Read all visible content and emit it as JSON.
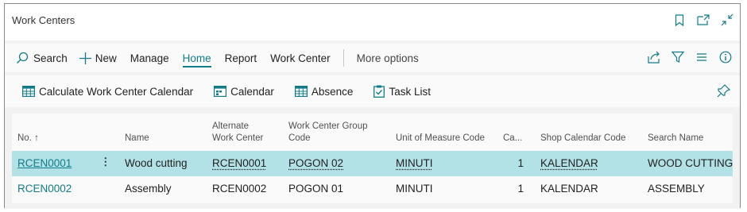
{
  "window": {
    "title": "Work Centers"
  },
  "actions": {
    "search": "Search",
    "new": "New",
    "manage": "Manage",
    "home": "Home",
    "report": "Report",
    "work_center": "Work Center",
    "more": "More options"
  },
  "promoted": {
    "calc": "Calculate Work Center Calendar",
    "calendar": "Calendar",
    "absence": "Absence",
    "task_list": "Task List"
  },
  "table": {
    "headers": {
      "no": "No. ↑",
      "name": "Name",
      "alt_1": "Alternate",
      "alt_2": "Work Center",
      "group_1": "Work Center Group",
      "group_2": "Code",
      "uom": "Unit of Measure Code",
      "cap": "Ca...",
      "shopcal": "Shop Calendar Code",
      "search": "Search Name"
    },
    "rows": [
      {
        "no": "RCEN0001",
        "name": "Wood cutting",
        "alt": "RCEN0001",
        "group": "POGON 02",
        "uom": "MINUTI",
        "cap": "1",
        "shopcal": "KALENDAR",
        "search": "WOOD CUTTING"
      },
      {
        "no": "RCEN0002",
        "name": "Assembly",
        "alt": "RCEN0002",
        "group": "POGON 01",
        "uom": "MINUTI",
        "cap": "1",
        "shopcal": "KALENDAR",
        "search": "ASSEMBLY"
      }
    ]
  },
  "colors": {
    "accent": "#117b8a",
    "selected_row": "#b2e2e6"
  }
}
